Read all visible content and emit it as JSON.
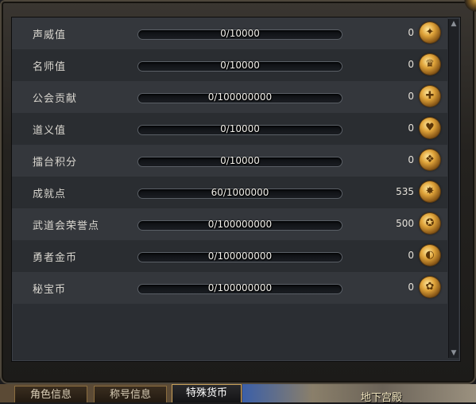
{
  "currencies": [
    {
      "label": "声威值",
      "progress": "0/10000",
      "value": "0",
      "icon": "prestige-emblem-icon",
      "glyph": "✦"
    },
    {
      "label": "名师值",
      "progress": "0/10000",
      "value": "0",
      "icon": "mentor-emblem-icon",
      "glyph": "♛"
    },
    {
      "label": "公会贡献",
      "progress": "0/100000000",
      "value": "0",
      "icon": "guild-emblem-icon",
      "glyph": "✚"
    },
    {
      "label": "道义值",
      "progress": "0/10000",
      "value": "0",
      "icon": "heart-emblem-icon",
      "glyph": "♥"
    },
    {
      "label": "擂台积分",
      "progress": "0/10000",
      "value": "0",
      "icon": "arena-emblem-icon",
      "glyph": "❖"
    },
    {
      "label": "成就点",
      "progress": "60/1000000",
      "value": "535",
      "icon": "achievement-emblem-icon",
      "glyph": "✸"
    },
    {
      "label": "武道会荣誉点",
      "progress": "0/100000000",
      "value": "500",
      "icon": "honor-emblem-icon",
      "glyph": "✪"
    },
    {
      "label": "勇者金币",
      "progress": "0/100000000",
      "value": "0",
      "icon": "hero-coin-icon",
      "glyph": "◐"
    },
    {
      "label": "秘宝币",
      "progress": "0/100000000",
      "value": "0",
      "icon": "treasure-coin-icon",
      "glyph": "✿"
    }
  ],
  "tabs": [
    {
      "label": "角色信息",
      "active": false
    },
    {
      "label": "称号信息",
      "active": false
    },
    {
      "label": "特殊货币",
      "active": true
    }
  ],
  "map_label": "地下宫殿",
  "colors": {
    "accent": "#e0a43a",
    "panel": "#2b2e33"
  }
}
